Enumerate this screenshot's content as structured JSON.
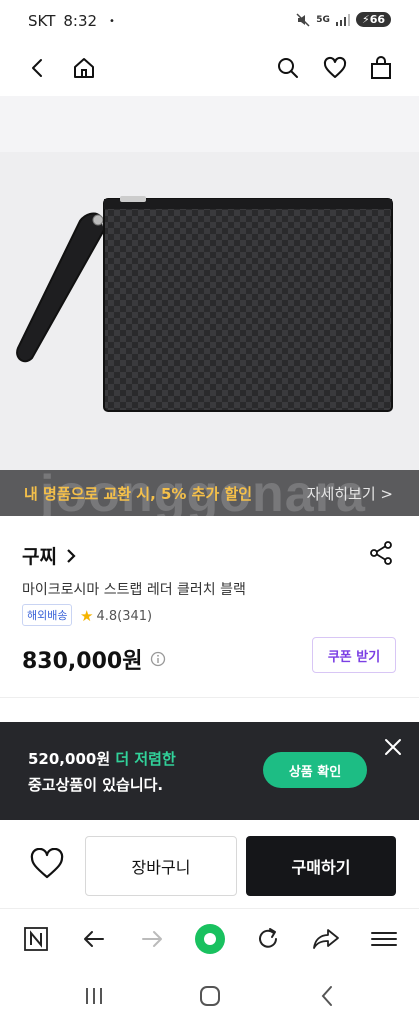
{
  "status_bar": {
    "carrier": "SKT",
    "time": "8:32",
    "dot": "•",
    "network": "5G",
    "battery": "66"
  },
  "header": {
    "icons": [
      "back-icon",
      "home-icon",
      "search-icon",
      "heart-icon",
      "bag-icon"
    ]
  },
  "promo": {
    "watermark": "joonggonara",
    "text": "내 명품으로 교환 시, 5% 추가 할인",
    "more_label": "자세히보기 >"
  },
  "product": {
    "brand": "구찌",
    "brand_chevron": "›",
    "title": "마이크로시마 스트랩 레더 클러치 블랙",
    "shipping_badge": "해외배송",
    "star": "★",
    "rating": "4.8(341)",
    "price": "830,000원",
    "coupon_label": "쿠폰 받기"
  },
  "popup": {
    "price": "520,000원",
    "highlight": "더 저렴한",
    "line2": "중고상품이 있습니다.",
    "cta_label": "상품 확인"
  },
  "buy_bar": {
    "cart_label": "장바구니",
    "buy_label": "구매하기"
  },
  "browser_toolbar": {
    "icons": [
      "naver-icon",
      "back-arrow-icon",
      "forward-arrow-icon",
      "green-home-icon",
      "refresh-icon",
      "share-icon",
      "menu-icon"
    ],
    "accent": "#19c15f"
  },
  "colors": {
    "promo_text": "#f5c04a",
    "highlight": "#31d29a",
    "cta": "#1dbd84",
    "coupon": "#7b3fe4"
  }
}
